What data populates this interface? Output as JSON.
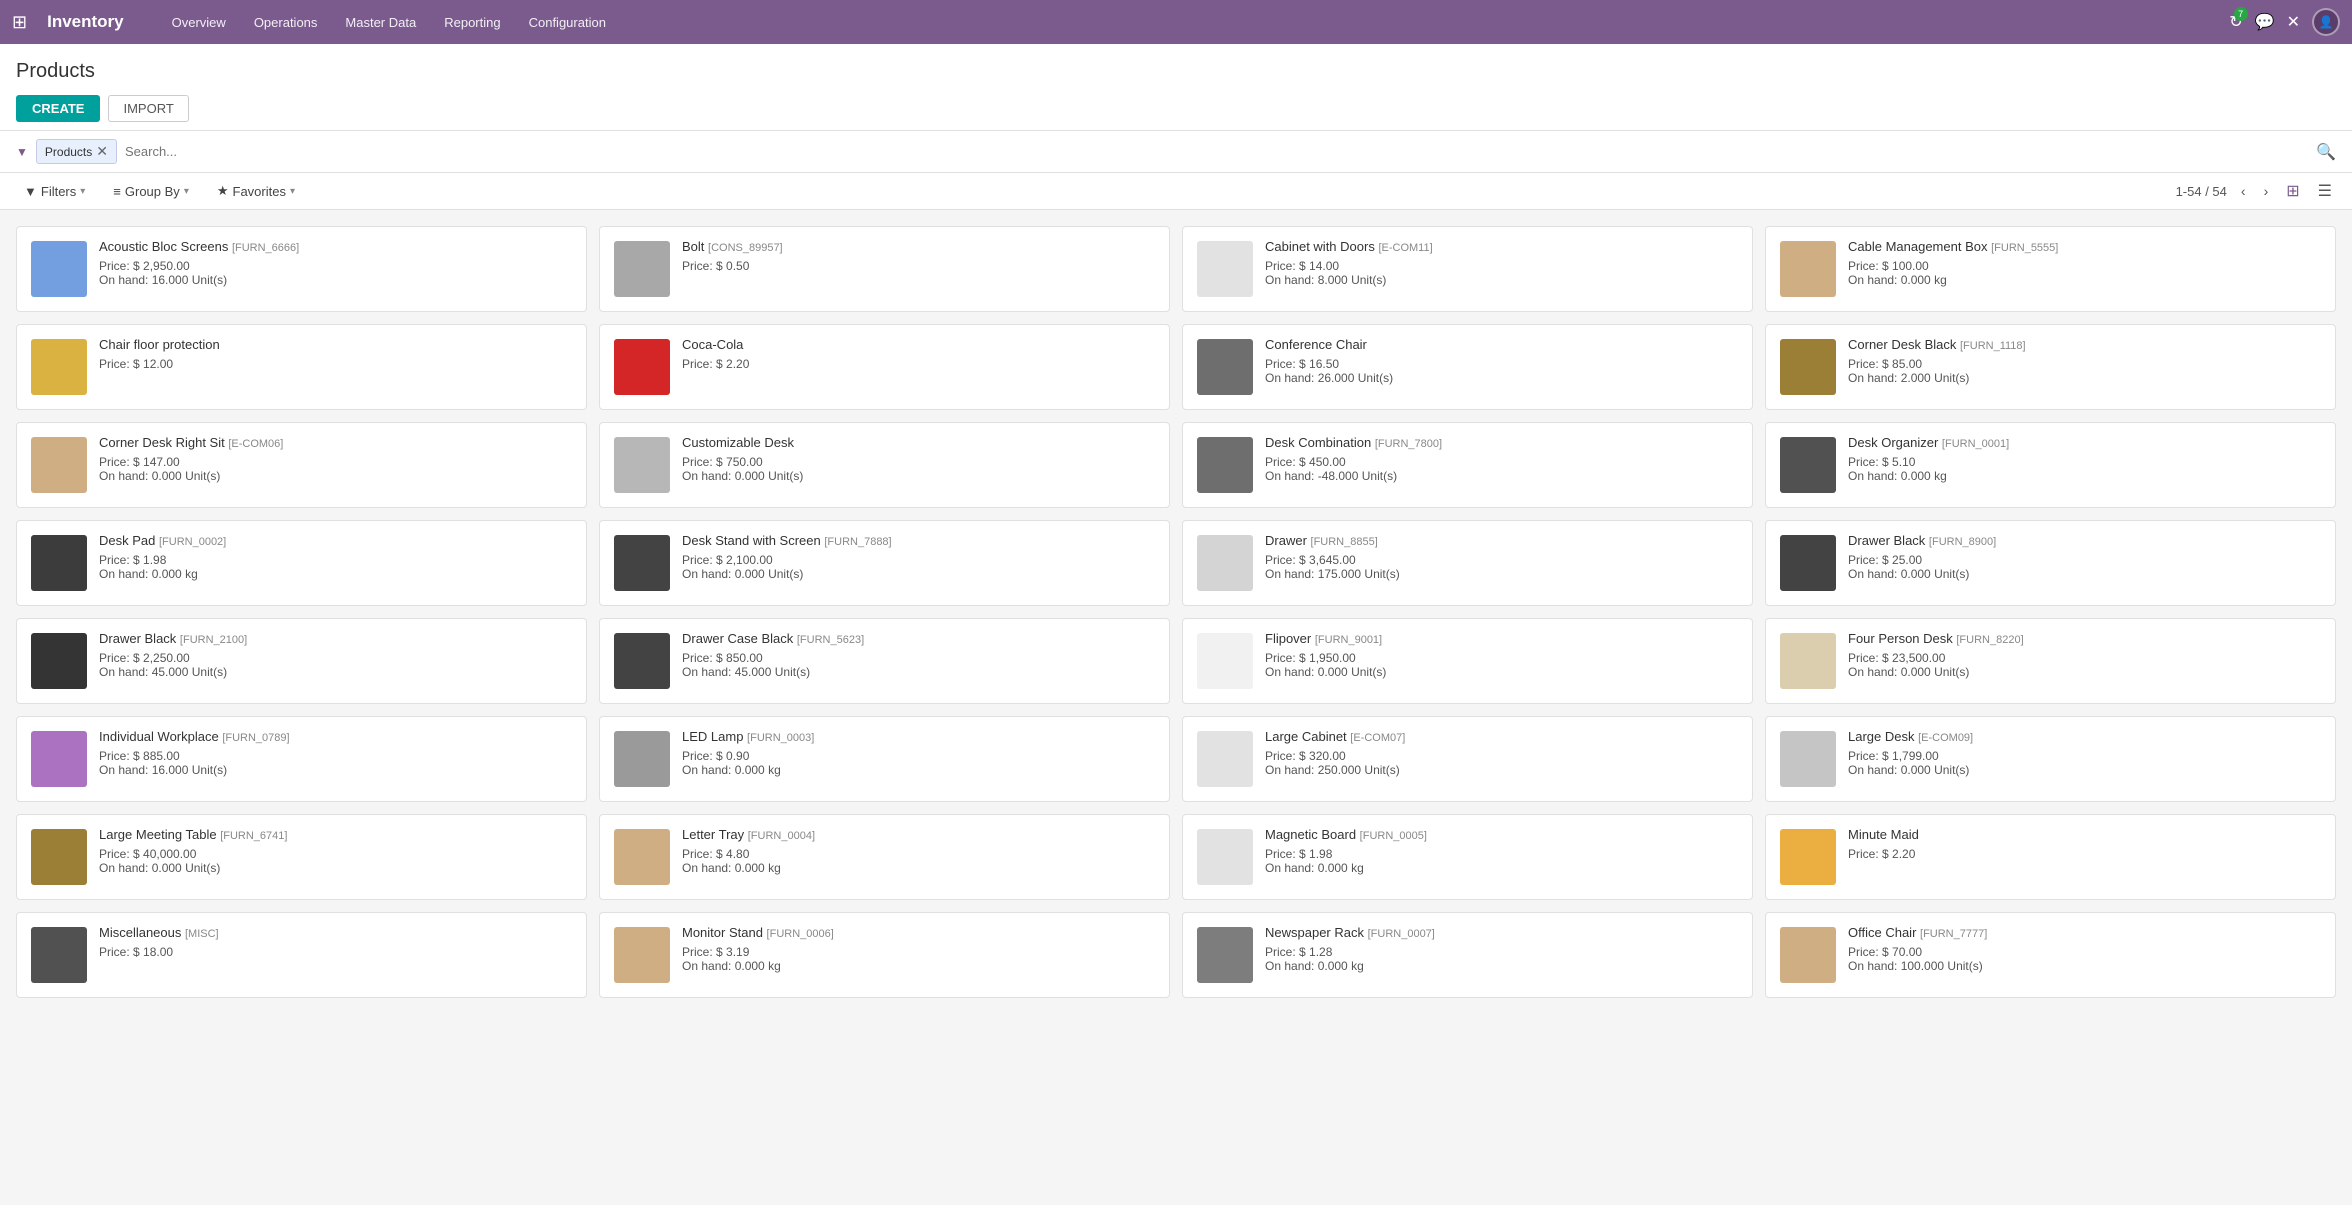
{
  "navbar": {
    "brand": "Inventory",
    "nav_items": [
      "Overview",
      "Operations",
      "Master Data",
      "Reporting",
      "Configuration"
    ],
    "badge_count": "7"
  },
  "page": {
    "title": "Products",
    "create_label": "CREATE",
    "import_label": "IMPORT"
  },
  "search": {
    "filter_tag": "Products",
    "placeholder": "Search..."
  },
  "toolbar": {
    "filters_label": "Filters",
    "group_by_label": "Group By",
    "favorites_label": "Favorites",
    "page_info": "1-54 / 54"
  },
  "products": [
    {
      "name": "Acoustic Bloc Screens",
      "code": "[FURN_6666]",
      "price": "Price: $ 2,950.00",
      "stock": "On hand: 16.000 Unit(s)",
      "color": "#5b8dd9"
    },
    {
      "name": "Bolt",
      "code": "[CONS_89957]",
      "price": "Price: $ 0.50",
      "stock": "",
      "color": "#999"
    },
    {
      "name": "Cabinet with Doors",
      "code": "[E-COM11]",
      "price": "Price: $ 14.00",
      "stock": "On hand: 8.000 Unit(s)",
      "color": "#ddd"
    },
    {
      "name": "Cable Management Box",
      "code": "[FURN_5555]",
      "price": "Price: $ 100.00",
      "stock": "On hand: 0.000 kg",
      "color": "#c8a06e"
    },
    {
      "name": "Chair floor protection",
      "code": "",
      "price": "Price: $ 12.00",
      "stock": "",
      "color": "#d4a520"
    },
    {
      "name": "Coca-Cola",
      "code": "",
      "price": "Price: $ 2.20",
      "stock": "",
      "color": "#cc0000"
    },
    {
      "name": "Conference Chair",
      "code": "",
      "price": "Price: $ 16.50",
      "stock": "On hand: 26.000 Unit(s)",
      "color": "#555"
    },
    {
      "name": "Corner Desk Black",
      "code": "[FURN_1118]",
      "price": "Price: $ 85.00",
      "stock": "On hand: 2.000 Unit(s)",
      "color": "#8B6914"
    },
    {
      "name": "Corner Desk Right Sit",
      "code": "[E-COM06]",
      "price": "Price: $ 147.00",
      "stock": "On hand: 0.000 Unit(s)",
      "color": "#c8a06e"
    },
    {
      "name": "Customizable Desk",
      "code": "",
      "price": "Price: $ 750.00",
      "stock": "On hand: 0.000 Unit(s)",
      "color": "#aaa"
    },
    {
      "name": "Desk Combination",
      "code": "[FURN_7800]",
      "price": "Price: $ 450.00",
      "stock": "On hand: -48.000 Unit(s)",
      "color": "#555"
    },
    {
      "name": "Desk Organizer",
      "code": "[FURN_0001]",
      "price": "Price: $ 5.10",
      "stock": "On hand: 0.000 kg",
      "color": "#333"
    },
    {
      "name": "Desk Pad",
      "code": "[FURN_0002]",
      "price": "Price: $ 1.98",
      "stock": "On hand: 0.000 kg",
      "color": "#1a1a1a"
    },
    {
      "name": "Desk Stand with Screen",
      "code": "[FURN_7888]",
      "price": "Price: $ 2,100.00",
      "stock": "On hand: 0.000 Unit(s)",
      "color": "#222"
    },
    {
      "name": "Drawer",
      "code": "[FURN_8855]",
      "price": "Price: $ 3,645.00",
      "stock": "On hand: 175.000 Unit(s)",
      "color": "#ccc"
    },
    {
      "name": "Drawer Black",
      "code": "[FURN_8900]",
      "price": "Price: $ 25.00",
      "stock": "On hand: 0.000 Unit(s)",
      "color": "#222"
    },
    {
      "name": "Drawer Black",
      "code": "[FURN_2100]",
      "price": "Price: $ 2,250.00",
      "stock": "On hand: 45.000 Unit(s)",
      "color": "#111"
    },
    {
      "name": "Drawer Case Black",
      "code": "[FURN_5623]",
      "price": "Price: $ 850.00",
      "stock": "On hand: 45.000 Unit(s)",
      "color": "#222"
    },
    {
      "name": "Flipover",
      "code": "[FURN_9001]",
      "price": "Price: $ 1,950.00",
      "stock": "On hand: 0.000 Unit(s)",
      "color": "#eee"
    },
    {
      "name": "Four Person Desk",
      "code": "[FURN_8220]",
      "price": "Price: $ 23,500.00",
      "stock": "On hand: 0.000 Unit(s)",
      "color": "#d4c5a0"
    },
    {
      "name": "Individual Workplace",
      "code": "[FURN_0789]",
      "price": "Price: $ 885.00",
      "stock": "On hand: 16.000 Unit(s)",
      "color": "#9b59b6"
    },
    {
      "name": "LED Lamp",
      "code": "[FURN_0003]",
      "price": "Price: $ 0.90",
      "stock": "On hand: 0.000 kg",
      "color": "#888"
    },
    {
      "name": "Large Cabinet",
      "code": "[E-COM07]",
      "price": "Price: $ 320.00",
      "stock": "On hand: 250.000 Unit(s)",
      "color": "#ddd"
    },
    {
      "name": "Large Desk",
      "code": "[E-COM09]",
      "price": "Price: $ 1,799.00",
      "stock": "On hand: 0.000 Unit(s)",
      "color": "#bbb"
    },
    {
      "name": "Large Meeting Table",
      "code": "[FURN_6741]",
      "price": "Price: $ 40,000.00",
      "stock": "On hand: 0.000 Unit(s)",
      "color": "#8B6914"
    },
    {
      "name": "Letter Tray",
      "code": "[FURN_0004]",
      "price": "Price: $ 4.80",
      "stock": "On hand: 0.000 kg",
      "color": "#c8a06e"
    },
    {
      "name": "Magnetic Board",
      "code": "[FURN_0005]",
      "price": "Price: $ 1.98",
      "stock": "On hand: 0.000 kg",
      "color": "#ddd"
    },
    {
      "name": "Minute Maid",
      "code": "",
      "price": "Price: $ 2.20",
      "stock": "",
      "color": "#e8a020"
    },
    {
      "name": "Miscellaneous",
      "code": "[MISC]",
      "price": "Price: $ 18.00",
      "stock": "",
      "color": "#333"
    },
    {
      "name": "Monitor Stand",
      "code": "[FURN_0006]",
      "price": "Price: $ 3.19",
      "stock": "On hand: 0.000 kg",
      "color": "#c8a06e"
    },
    {
      "name": "Newspaper Rack",
      "code": "[FURN_0007]",
      "price": "Price: $ 1.28",
      "stock": "On hand: 0.000 kg",
      "color": "#666"
    },
    {
      "name": "Office Chair",
      "code": "[FURN_7777]",
      "price": "Price: $ 70.00",
      "stock": "On hand: 100.000 Unit(s)",
      "color": "#c8a06e"
    }
  ]
}
